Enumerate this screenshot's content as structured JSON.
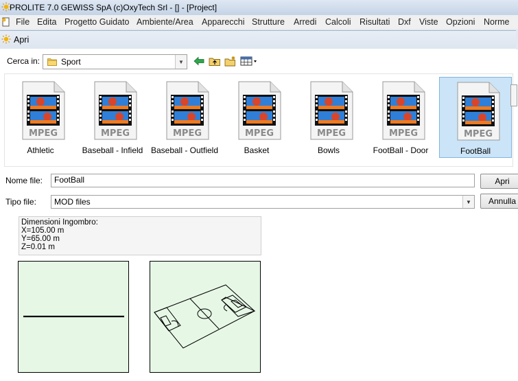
{
  "app": {
    "title": "PROLITE 7.0 GEWISS SpA (c)OxyTech Srl - [] - [Project]"
  },
  "menubar": {
    "items": [
      "File",
      "Edita",
      "Progetto Guidato",
      "Ambiente/Area",
      "Apparecchi",
      "Strutture",
      "Arredi",
      "Calcoli",
      "Risultati",
      "Dxf",
      "Viste",
      "Opzioni",
      "Norme"
    ]
  },
  "dialog": {
    "title": "Apri",
    "lookin_label": "Cerca in:",
    "lookin_value": "Sport",
    "files": [
      {
        "name": "Athletic",
        "type": "MPEG"
      },
      {
        "name": "Baseball - Infield",
        "type": "MPEG"
      },
      {
        "name": "Baseball - Outfield",
        "type": "MPEG"
      },
      {
        "name": "Basket",
        "type": "MPEG"
      },
      {
        "name": "Bowls",
        "type": "MPEG"
      },
      {
        "name": "FootBall - Door",
        "type": "MPEG"
      },
      {
        "name": "FootBall",
        "type": "MPEG"
      }
    ],
    "selected_index": 6,
    "filename_label": "Nome file:",
    "filename_value": "FootBall",
    "filetype_label": "Tipo file:",
    "filetype_value": "MOD files",
    "open_button": "Apri",
    "cancel_button": "Annulla",
    "info": {
      "heading": "Dimensioni Ingombro:",
      "x": "X=105.00 m",
      "y": "Y=65.00 m",
      "z": "Z=0.01 m"
    }
  },
  "icons": {
    "app": "sun-icon",
    "folder": "folder-icon",
    "back": "back-arrow-icon",
    "up": "folder-up-icon",
    "new_folder": "new-folder-icon",
    "view_menu": "view-menu-icon",
    "file": "mpeg-file-icon"
  },
  "colors": {
    "selection": "#cce4f7",
    "preview_bg": "#e6f7e6"
  }
}
